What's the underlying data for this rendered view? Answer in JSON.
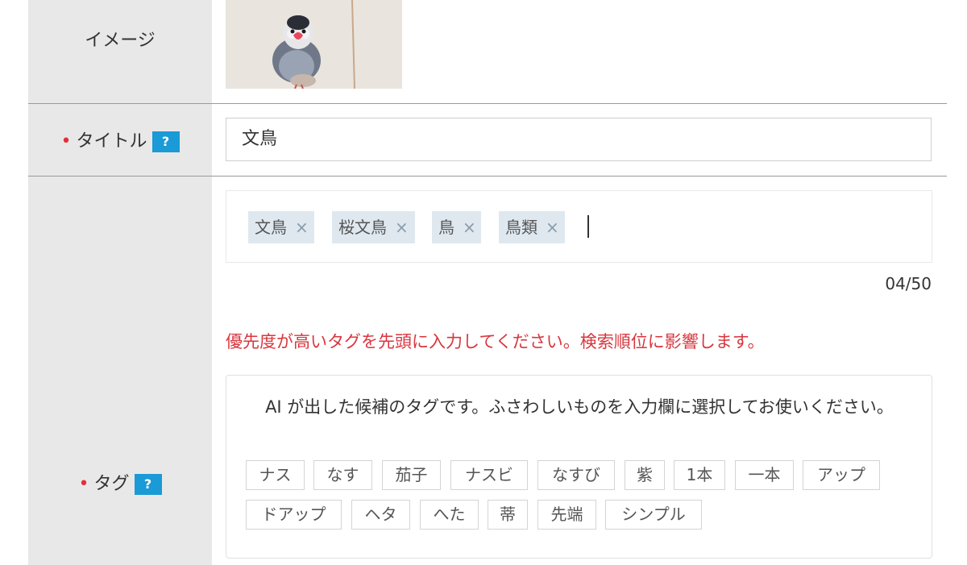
{
  "image_row": {
    "label": "イメージ"
  },
  "title_row": {
    "label": "タイトル",
    "help": "?",
    "value": "文鳥"
  },
  "tag_row": {
    "label": "タグ",
    "help": "?",
    "tags": [
      "文鳥",
      "桜文鳥",
      "鳥",
      "鳥類"
    ],
    "remove_glyph": "×",
    "counter": "04/50",
    "warning": "優先度が高いタグを先頭に入力してください。検索順位に影響します。",
    "ai_description": "AI が出した候補のタグです。ふさわしいものを入力欄に選択してお使いください。",
    "suggestions": [
      "ナス",
      "なす",
      "茄子",
      "ナスビ",
      "なすび",
      "紫",
      "1本",
      "一本",
      "アップ",
      "ドアップ",
      "ヘタ",
      "へた",
      "蒂",
      "先端",
      "シンプル"
    ]
  },
  "colors": {
    "label_bg": "#e8e8e8",
    "required_dot": "#e0303c",
    "help_badge": "#1a9ad6",
    "tag_chip": "#dfe8ef",
    "warning": "#d9363e"
  },
  "icons": {
    "required": "required-dot-icon",
    "help": "question-icon",
    "remove": "close-icon"
  }
}
